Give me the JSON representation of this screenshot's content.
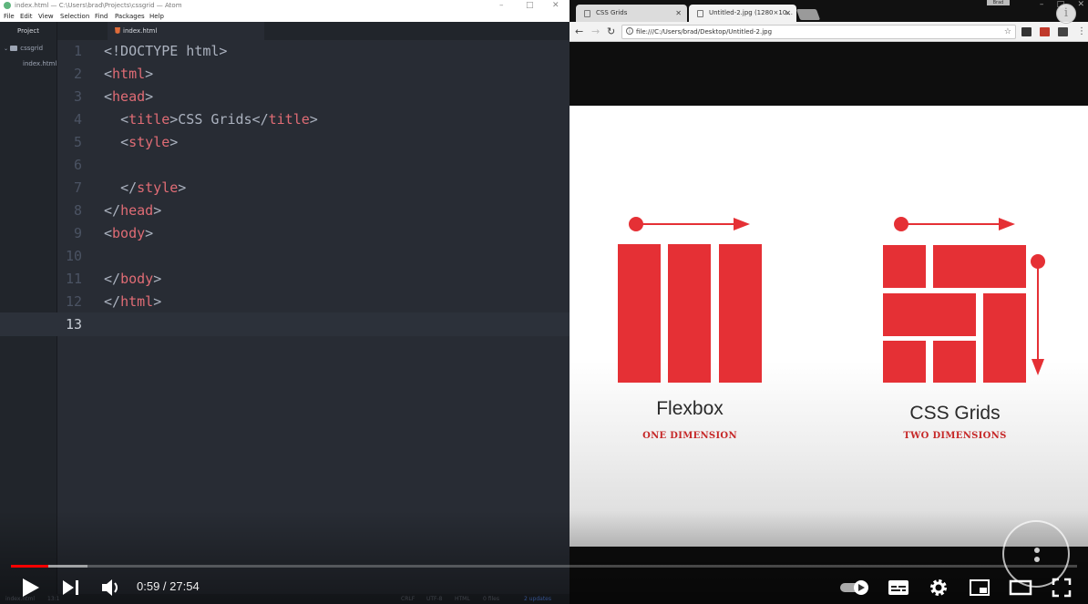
{
  "atom": {
    "window_title": "index.html — C:\\Users\\brad\\Projects\\cssgrid — Atom",
    "menu": [
      "File",
      "Edit",
      "View",
      "Selection",
      "Find",
      "Packages",
      "Help"
    ],
    "tree": {
      "header": "Project",
      "folder": "cssgrid",
      "file": "index.html"
    },
    "tab_label": "index.html",
    "line_numbers": [
      "1",
      "2",
      "3",
      "4",
      "5",
      "6",
      "7",
      "8",
      "9",
      "10",
      "11",
      "12",
      "13"
    ],
    "code": {
      "l1": "<!DOCTYPE html>",
      "l2": {
        "open": "<",
        "tag": "html",
        "close": ">"
      },
      "l3": {
        "open": "<",
        "tag": "head",
        "close": ">"
      },
      "l4": {
        "indent": "  ",
        "open": "<",
        "tag": "title",
        "mid": ">CSS Grids</",
        "tag2": "title",
        "close": ">"
      },
      "l5": {
        "indent": "  ",
        "open": "<",
        "tag": "style",
        "close": ">"
      },
      "l7": {
        "indent": "  ",
        "open": "</",
        "tag": "style",
        "close": ">"
      },
      "l8": {
        "open": "</",
        "tag": "head",
        "close": ">"
      },
      "l9": {
        "open": "<",
        "tag": "body",
        "close": ">"
      },
      "l11": {
        "open": "</",
        "tag": "body",
        "close": ">"
      },
      "l12": {
        "open": "</",
        "tag": "html",
        "close": ">"
      }
    },
    "status": {
      "file": "index.html",
      "cursor": "13:1",
      "line_ending": "CRLF",
      "encoding": "UTF-8",
      "grammar": "HTML",
      "files": "0 files",
      "updates": "2 updates"
    }
  },
  "chrome": {
    "tabs": [
      {
        "label": "CSS Grids"
      },
      {
        "label": "Untitled-2.jpg (1280×10..."
      }
    ],
    "url": "file:///C:/Users/brad/Desktop/Untitled-2.jpg",
    "profile": "Brad"
  },
  "slide": {
    "left_title": "Flexbox",
    "left_subtitle": "ONE DIMENSION",
    "right_title": "CSS Grids",
    "right_subtitle": "TWO DIMENSIONS",
    "accent_color": "#e53035"
  },
  "player": {
    "time": "0:59 / 27:54",
    "played_fraction": 0.035,
    "buffered_fraction": 0.072,
    "icons": [
      "play-icon",
      "next-icon",
      "volume-icon",
      "autoplay-toggle",
      "subtitles-icon",
      "settings-icon",
      "miniplayer-icon",
      "theater-icon",
      "fullscreen-icon"
    ]
  }
}
